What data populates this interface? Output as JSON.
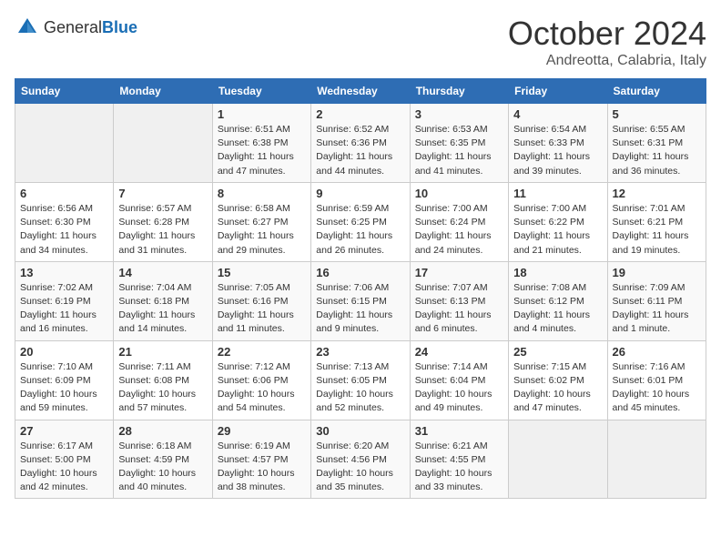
{
  "header": {
    "logo_general": "General",
    "logo_blue": "Blue",
    "month_title": "October 2024",
    "location": "Andreotta, Calabria, Italy"
  },
  "weekdays": [
    "Sunday",
    "Monday",
    "Tuesday",
    "Wednesday",
    "Thursday",
    "Friday",
    "Saturday"
  ],
  "weeks": [
    [
      {
        "day": "",
        "sunrise": "",
        "sunset": "",
        "daylight": ""
      },
      {
        "day": "",
        "sunrise": "",
        "sunset": "",
        "daylight": ""
      },
      {
        "day": "1",
        "sunrise": "Sunrise: 6:51 AM",
        "sunset": "Sunset: 6:38 PM",
        "daylight": "Daylight: 11 hours and 47 minutes."
      },
      {
        "day": "2",
        "sunrise": "Sunrise: 6:52 AM",
        "sunset": "Sunset: 6:36 PM",
        "daylight": "Daylight: 11 hours and 44 minutes."
      },
      {
        "day": "3",
        "sunrise": "Sunrise: 6:53 AM",
        "sunset": "Sunset: 6:35 PM",
        "daylight": "Daylight: 11 hours and 41 minutes."
      },
      {
        "day": "4",
        "sunrise": "Sunrise: 6:54 AM",
        "sunset": "Sunset: 6:33 PM",
        "daylight": "Daylight: 11 hours and 39 minutes."
      },
      {
        "day": "5",
        "sunrise": "Sunrise: 6:55 AM",
        "sunset": "Sunset: 6:31 PM",
        "daylight": "Daylight: 11 hours and 36 minutes."
      }
    ],
    [
      {
        "day": "6",
        "sunrise": "Sunrise: 6:56 AM",
        "sunset": "Sunset: 6:30 PM",
        "daylight": "Daylight: 11 hours and 34 minutes."
      },
      {
        "day": "7",
        "sunrise": "Sunrise: 6:57 AM",
        "sunset": "Sunset: 6:28 PM",
        "daylight": "Daylight: 11 hours and 31 minutes."
      },
      {
        "day": "8",
        "sunrise": "Sunrise: 6:58 AM",
        "sunset": "Sunset: 6:27 PM",
        "daylight": "Daylight: 11 hours and 29 minutes."
      },
      {
        "day": "9",
        "sunrise": "Sunrise: 6:59 AM",
        "sunset": "Sunset: 6:25 PM",
        "daylight": "Daylight: 11 hours and 26 minutes."
      },
      {
        "day": "10",
        "sunrise": "Sunrise: 7:00 AM",
        "sunset": "Sunset: 6:24 PM",
        "daylight": "Daylight: 11 hours and 24 minutes."
      },
      {
        "day": "11",
        "sunrise": "Sunrise: 7:00 AM",
        "sunset": "Sunset: 6:22 PM",
        "daylight": "Daylight: 11 hours and 21 minutes."
      },
      {
        "day": "12",
        "sunrise": "Sunrise: 7:01 AM",
        "sunset": "Sunset: 6:21 PM",
        "daylight": "Daylight: 11 hours and 19 minutes."
      }
    ],
    [
      {
        "day": "13",
        "sunrise": "Sunrise: 7:02 AM",
        "sunset": "Sunset: 6:19 PM",
        "daylight": "Daylight: 11 hours and 16 minutes."
      },
      {
        "day": "14",
        "sunrise": "Sunrise: 7:04 AM",
        "sunset": "Sunset: 6:18 PM",
        "daylight": "Daylight: 11 hours and 14 minutes."
      },
      {
        "day": "15",
        "sunrise": "Sunrise: 7:05 AM",
        "sunset": "Sunset: 6:16 PM",
        "daylight": "Daylight: 11 hours and 11 minutes."
      },
      {
        "day": "16",
        "sunrise": "Sunrise: 7:06 AM",
        "sunset": "Sunset: 6:15 PM",
        "daylight": "Daylight: 11 hours and 9 minutes."
      },
      {
        "day": "17",
        "sunrise": "Sunrise: 7:07 AM",
        "sunset": "Sunset: 6:13 PM",
        "daylight": "Daylight: 11 hours and 6 minutes."
      },
      {
        "day": "18",
        "sunrise": "Sunrise: 7:08 AM",
        "sunset": "Sunset: 6:12 PM",
        "daylight": "Daylight: 11 hours and 4 minutes."
      },
      {
        "day": "19",
        "sunrise": "Sunrise: 7:09 AM",
        "sunset": "Sunset: 6:11 PM",
        "daylight": "Daylight: 11 hours and 1 minute."
      }
    ],
    [
      {
        "day": "20",
        "sunrise": "Sunrise: 7:10 AM",
        "sunset": "Sunset: 6:09 PM",
        "daylight": "Daylight: 10 hours and 59 minutes."
      },
      {
        "day": "21",
        "sunrise": "Sunrise: 7:11 AM",
        "sunset": "Sunset: 6:08 PM",
        "daylight": "Daylight: 10 hours and 57 minutes."
      },
      {
        "day": "22",
        "sunrise": "Sunrise: 7:12 AM",
        "sunset": "Sunset: 6:06 PM",
        "daylight": "Daylight: 10 hours and 54 minutes."
      },
      {
        "day": "23",
        "sunrise": "Sunrise: 7:13 AM",
        "sunset": "Sunset: 6:05 PM",
        "daylight": "Daylight: 10 hours and 52 minutes."
      },
      {
        "day": "24",
        "sunrise": "Sunrise: 7:14 AM",
        "sunset": "Sunset: 6:04 PM",
        "daylight": "Daylight: 10 hours and 49 minutes."
      },
      {
        "day": "25",
        "sunrise": "Sunrise: 7:15 AM",
        "sunset": "Sunset: 6:02 PM",
        "daylight": "Daylight: 10 hours and 47 minutes."
      },
      {
        "day": "26",
        "sunrise": "Sunrise: 7:16 AM",
        "sunset": "Sunset: 6:01 PM",
        "daylight": "Daylight: 10 hours and 45 minutes."
      }
    ],
    [
      {
        "day": "27",
        "sunrise": "Sunrise: 6:17 AM",
        "sunset": "Sunset: 5:00 PM",
        "daylight": "Daylight: 10 hours and 42 minutes."
      },
      {
        "day": "28",
        "sunrise": "Sunrise: 6:18 AM",
        "sunset": "Sunset: 4:59 PM",
        "daylight": "Daylight: 10 hours and 40 minutes."
      },
      {
        "day": "29",
        "sunrise": "Sunrise: 6:19 AM",
        "sunset": "Sunset: 4:57 PM",
        "daylight": "Daylight: 10 hours and 38 minutes."
      },
      {
        "day": "30",
        "sunrise": "Sunrise: 6:20 AM",
        "sunset": "Sunset: 4:56 PM",
        "daylight": "Daylight: 10 hours and 35 minutes."
      },
      {
        "day": "31",
        "sunrise": "Sunrise: 6:21 AM",
        "sunset": "Sunset: 4:55 PM",
        "daylight": "Daylight: 10 hours and 33 minutes."
      },
      {
        "day": "",
        "sunrise": "",
        "sunset": "",
        "daylight": ""
      },
      {
        "day": "",
        "sunrise": "",
        "sunset": "",
        "daylight": ""
      }
    ]
  ]
}
